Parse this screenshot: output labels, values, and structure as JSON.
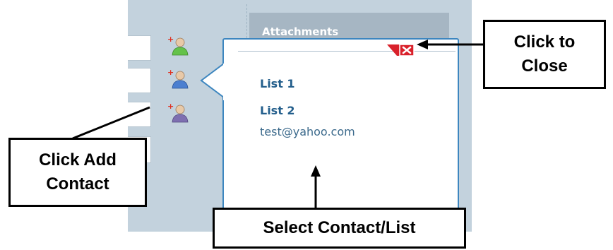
{
  "attachments_title": "Attachments",
  "popup": {
    "items": [
      "List 1",
      "List 2"
    ],
    "email": "test@yahoo.com",
    "close_icon": "close-x-icon"
  },
  "icons": {
    "contact_icons": [
      "add-contact-icon-green",
      "add-contact-icon-blue",
      "add-contact-icon-purple"
    ]
  },
  "callouts": {
    "close": [
      "Click to",
      "Close"
    ],
    "add_contact": [
      "Click Add",
      "Contact"
    ],
    "select": "Select Contact/List"
  },
  "colors": {
    "popup_border": "#3d86bf",
    "panel_bg": "#c3d2dd",
    "link_text": "#245f8c",
    "close_red": "#d9212b"
  }
}
